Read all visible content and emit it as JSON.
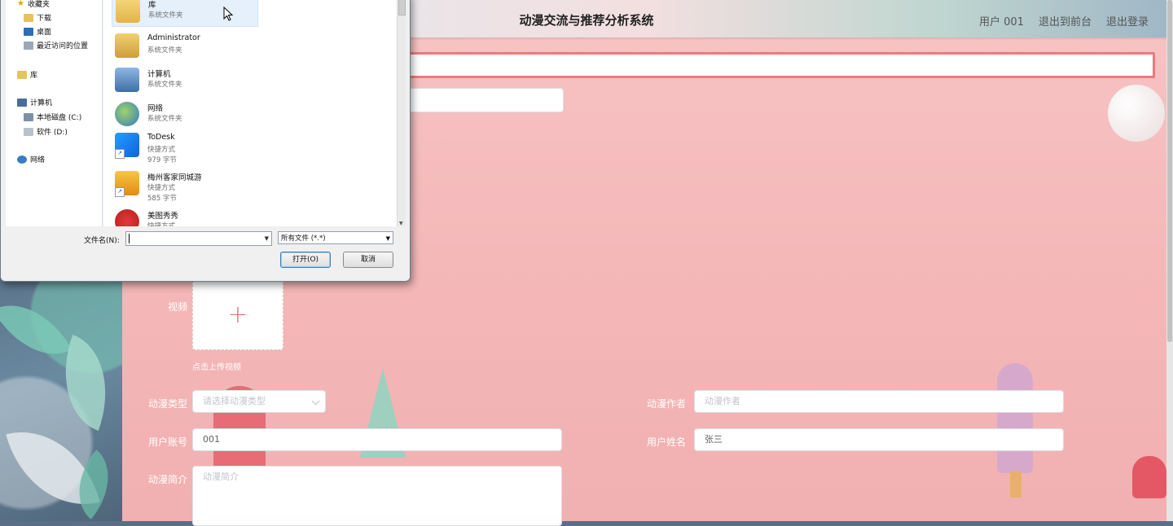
{
  "app": {
    "title": "动漫交流与推荐分析系统",
    "links": [
      {
        "label": "用户 001"
      },
      {
        "label": "退出到前台"
      },
      {
        "label": "退出登录"
      }
    ]
  },
  "form": {
    "video_label": "视频",
    "video_tip": "点击上传视频",
    "type_label": "动漫类型",
    "type_placeholder": "请选择动漫类型",
    "author_label": "动漫作者",
    "author_placeholder": "动漫作者",
    "account_label": "用户账号",
    "account_value": "001",
    "name_label": "用户姓名",
    "name_value": "张三",
    "intro_label": "动漫简介",
    "intro_placeholder": "动漫简介"
  },
  "dialog": {
    "nav": [
      {
        "label": "收藏夹"
      },
      {
        "label": "下载"
      },
      {
        "label": "桌面"
      },
      {
        "label": "最近访问的位置"
      },
      {
        "label": "库"
      },
      {
        "label": "计算机"
      },
      {
        "label": "本地磁盘 (C:)"
      },
      {
        "label": "软件 (D:)"
      },
      {
        "label": "网络"
      }
    ],
    "files": [
      {
        "name": "库",
        "type": "系统文件夹",
        "size": ""
      },
      {
        "name": "Administrator",
        "type": "系统文件夹",
        "size": ""
      },
      {
        "name": "计算机",
        "type": "系统文件夹",
        "size": ""
      },
      {
        "name": "网络",
        "type": "系统文件夹",
        "size": ""
      },
      {
        "name": "ToDesk",
        "type": "快捷方式",
        "size": "979 字节"
      },
      {
        "name": "梅州客家同城游",
        "type": "快捷方式",
        "size": "585 字节"
      },
      {
        "name": "美图秀秀",
        "type": "快捷方式",
        "size": ""
      }
    ],
    "filename_label": "文件名(N):",
    "filename_value": "",
    "filetype_value": "所有文件 (*.*)",
    "open_button": "打开(O)",
    "cancel_button": "取消"
  },
  "colors": {
    "panel_pink": "#f5b9ba",
    "accent_red": "#e87c82",
    "selection_blue": "#e5f0fb"
  }
}
